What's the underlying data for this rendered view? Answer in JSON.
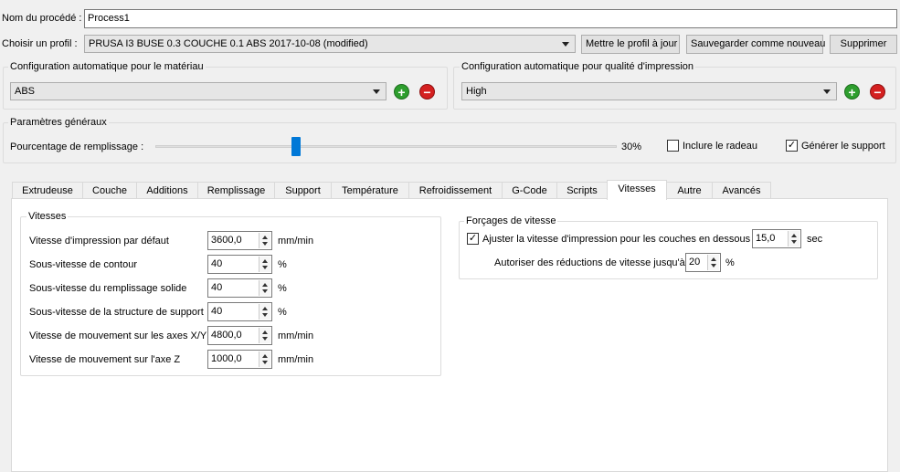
{
  "process": {
    "label": "Nom du procédé :",
    "value": "Process1"
  },
  "profile": {
    "label": "Choisir un profil :",
    "value": "PRUSA I3 BUSE 0.3 COUCHE 0.1 ABS 2017-10-08 (modified)",
    "update_button": "Mettre le profil à jour",
    "save_new_button": "Sauvegarder comme nouveau",
    "delete_button": "Supprimer"
  },
  "material_config": {
    "title": "Configuration automatique pour le matériau",
    "value": "ABS"
  },
  "quality_config": {
    "title": "Configuration automatique pour qualité d'impression",
    "value": "High"
  },
  "general": {
    "title": "Paramètres généraux",
    "infill_label": "Pourcentage de remplissage :",
    "infill_value": "30%",
    "infill_fraction": 0.3,
    "raft_label": "Inclure le radeau",
    "raft_checked": false,
    "support_label": "Générer le support",
    "support_checked": true
  },
  "tabs": [
    {
      "label": "Extrudeuse"
    },
    {
      "label": "Couche"
    },
    {
      "label": "Additions"
    },
    {
      "label": "Remplissage"
    },
    {
      "label": "Support"
    },
    {
      "label": "Température"
    },
    {
      "label": "Refroidissement"
    },
    {
      "label": "G-Code"
    },
    {
      "label": "Scripts"
    },
    {
      "label": "Vitesses",
      "active": true
    },
    {
      "label": "Autre"
    },
    {
      "label": "Avancés"
    }
  ],
  "speeds": {
    "title": "Vitesses",
    "rows": [
      {
        "label": "Vitesse d'impression par défaut",
        "value": "3600,0",
        "unit": "mm/min"
      },
      {
        "label": "Sous-vitesse de contour",
        "value": "40",
        "unit": "%"
      },
      {
        "label": "Sous-vitesse du remplissage solide",
        "value": "40",
        "unit": "%"
      },
      {
        "label": "Sous-vitesse de la structure de support",
        "value": "40",
        "unit": "%"
      },
      {
        "label": "Vitesse de mouvement sur les axes X/Y",
        "value": "4800,0",
        "unit": "mm/min"
      },
      {
        "label": "Vitesse de mouvement sur l'axe Z",
        "value": "1000,0",
        "unit": "mm/min"
      }
    ]
  },
  "overrides": {
    "title": "Forçages de vitesse",
    "adjust_label": "Ajuster la vitesse d'impression pour les couches en dessous",
    "adjust_checked": true,
    "adjust_value": "15,0",
    "adjust_unit": "sec",
    "reduce_label": "Autoriser des réductions de vitesse jusqu'à",
    "reduce_value": "20",
    "reduce_unit": "%"
  },
  "colors": {
    "accent": "#0078d7",
    "add": "#2e9e2e",
    "remove": "#d42020"
  }
}
